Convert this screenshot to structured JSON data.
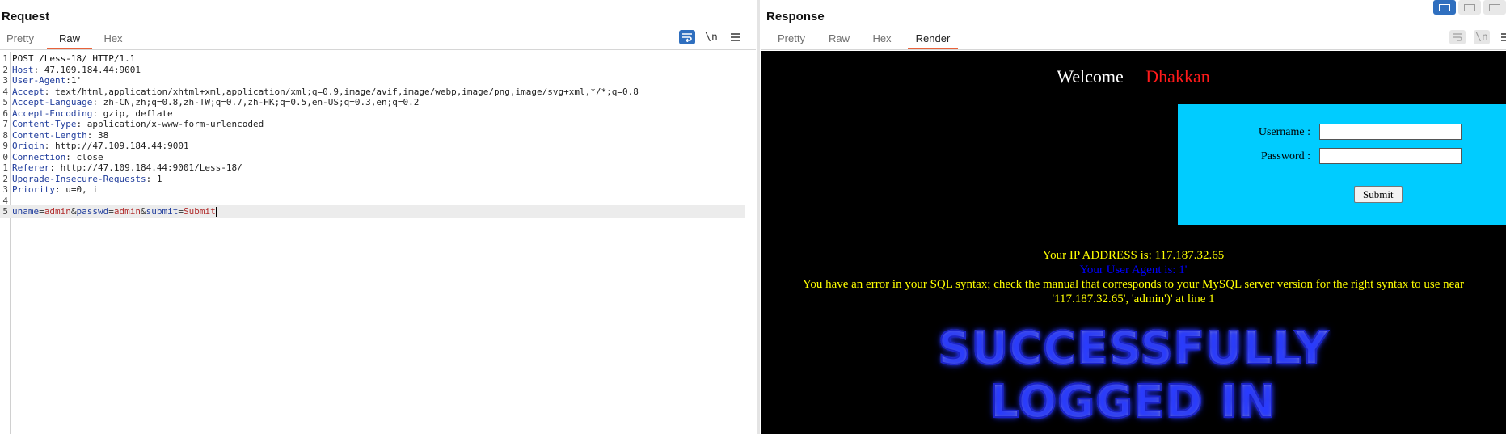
{
  "request": {
    "title": "Request",
    "tabs": [
      "Pretty",
      "Raw",
      "Hex"
    ],
    "active_tab": "Raw",
    "toolbar": {
      "wrap_icon": "wrap-lines-icon",
      "newline_label": "\\n",
      "menu_icon": "hamburger-menu-icon"
    },
    "lines": [
      {
        "num": "1",
        "plain": "POST /Less-18/ HTTP/1.1"
      },
      {
        "num": "2",
        "name": "Host",
        "value": " 47.109.184.44:9001"
      },
      {
        "num": "3",
        "name": "User-Agent",
        "value": "1'"
      },
      {
        "num": "4",
        "name": "Accept",
        "value": " text/html,application/xhtml+xml,application/xml;q=0.9,image/avif,image/webp,image/png,image/svg+xml,*/*;q=0.8"
      },
      {
        "num": "5",
        "name": "Accept-Language",
        "value": " zh-CN,zh;q=0.8,zh-TW;q=0.7,zh-HK;q=0.5,en-US;q=0.3,en;q=0.2"
      },
      {
        "num": "6",
        "name": "Accept-Encoding",
        "value": " gzip, deflate"
      },
      {
        "num": "7",
        "name": "Content-Type",
        "value": " application/x-www-form-urlencoded"
      },
      {
        "num": "8",
        "name": "Content-Length",
        "value": " 38"
      },
      {
        "num": "9",
        "name": "Origin",
        "value": " http://47.109.184.44:9001"
      },
      {
        "num": "0",
        "name": "Connection",
        "value": " close"
      },
      {
        "num": "1",
        "name": "Referer",
        "value": " http://47.109.184.44:9001/Less-18/"
      },
      {
        "num": "2",
        "name": "Upgrade-Insecure-Requests",
        "value": " 1"
      },
      {
        "num": "3",
        "name": "Priority",
        "value": " u=0, i"
      },
      {
        "num": "4",
        "plain": ""
      },
      {
        "num": "5",
        "params": [
          [
            "uname",
            "admin"
          ],
          [
            "passwd",
            "admin"
          ],
          [
            "submit",
            "Submit"
          ]
        ]
      }
    ]
  },
  "response": {
    "title": "Response",
    "tabs": [
      "Pretty",
      "Raw",
      "Hex",
      "Render"
    ],
    "active_tab": "Render",
    "render": {
      "welcome_word": "Welcome",
      "welcome_name": "Dhakkan",
      "username_label": "Username :",
      "password_label": "Password :",
      "username_value": "",
      "password_value": "",
      "submit_label": "Submit",
      "ip_line": "Your IP ADDRESS is: 117.187.32.65",
      "ua_line": "Your User Agent is: 1'",
      "error_line": "You have an error in your SQL syntax; check the manual that corresponds to your MySQL server version for the right syntax to use near '117.187.32.65', 'admin')' at line 1",
      "success_line1": "SUCCESSFULLY",
      "success_line2": "LOGGED IN"
    }
  },
  "colors": {
    "accent_tab_underline": "#e8623a",
    "header_name": "#1f3c9c",
    "param_value": "#b22d2d",
    "render_bg": "#000000",
    "login_box": "#00ccff",
    "welcome_name": "#ff1a1a",
    "message_yellow": "#ffff00",
    "user_agent_blue": "#0000ff"
  }
}
